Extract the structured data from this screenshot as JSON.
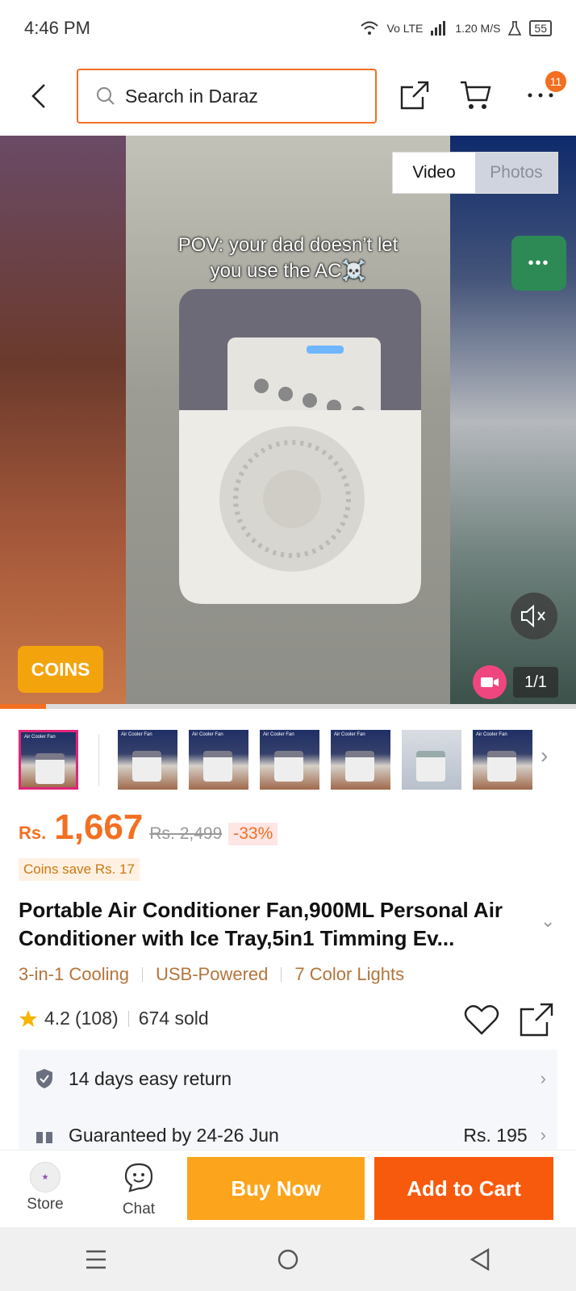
{
  "status_bar": {
    "time": "4:46 PM",
    "network": "Vo LTE",
    "speed": "1.20 M/S",
    "battery": "55"
  },
  "top_nav": {
    "search_placeholder": "Search in Daraz",
    "menu_badge": "11"
  },
  "media": {
    "tabs": [
      "Video",
      "Photos"
    ],
    "active_tab": "Video",
    "caption_line1": "POV: your dad doesn’t let",
    "caption_line2": "you use the AC☠️",
    "coins_button": "COINS",
    "counter": "1/1",
    "progress": 0.08
  },
  "thumbnails": {
    "count": 7,
    "label": "Air Cooler Fan"
  },
  "product": {
    "currency": "Rs.",
    "price": "1,667",
    "original_price": "Rs. 2,499",
    "discount": "-33%",
    "coins_save": "Coins save Rs. 17",
    "title": "Portable Air Conditioner Fan,900ML Personal Air Conditioner with Ice Tray,5in1 Timming Ev...",
    "tags": [
      "3-in-1 Cooling",
      "USB-Powered",
      "7 Color Lights"
    ],
    "rating": "4.2",
    "reviews": "(108)",
    "sold": "674 sold"
  },
  "services": {
    "return": "14 days easy return",
    "delivery": "Guaranteed by 24-26 Jun",
    "delivery_fee": "Rs. 195"
  },
  "bottom_bar": {
    "store": "Store",
    "chat": "Chat",
    "buy_now": "Buy Now",
    "add_to_cart": "Add to Cart"
  },
  "colors": {
    "brand": "#f36f21",
    "buy_now": "#fca41b",
    "add_to_cart": "#f85a0d"
  }
}
